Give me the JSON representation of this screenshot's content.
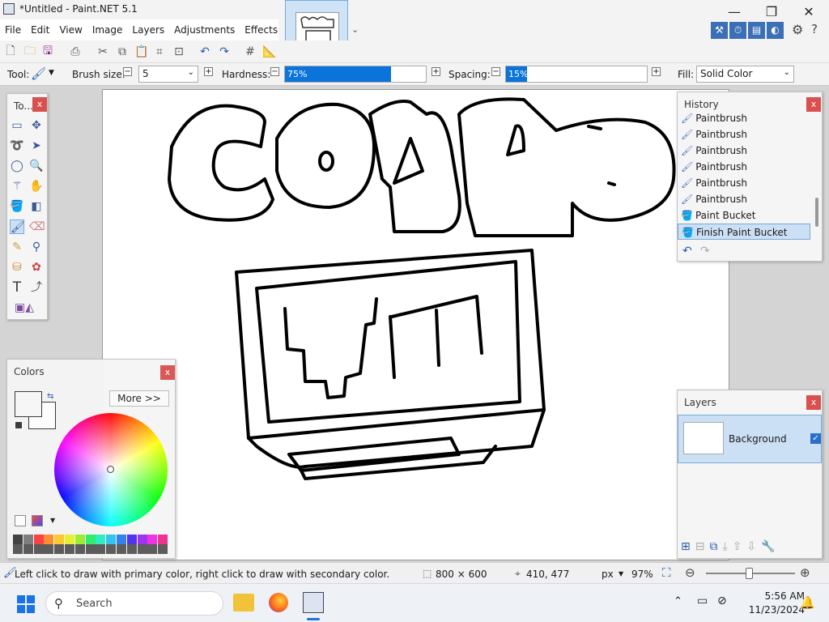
{
  "window": {
    "title": "*Untitled - Paint.NET 5.1",
    "minimize": "—",
    "maximize": "❐",
    "close": "✕"
  },
  "menu": [
    "File",
    "Edit",
    "View",
    "Image",
    "Layers",
    "Adjustments",
    "Effects"
  ],
  "toolbar": {
    "tool_label": "Tool:",
    "brush_size_label": "Brush size:",
    "brush_size_value": "5",
    "hardness_label": "Hardness:",
    "hardness_value": "75%",
    "hardness_fraction": 0.75,
    "spacing_label": "Spacing:",
    "spacing_value": "15%",
    "spacing_fraction": 0.15,
    "fill_label": "Fill:",
    "fill_value": "Solid Color"
  },
  "tools_panel": {
    "title": "To...",
    "close": "x"
  },
  "history_panel": {
    "title": "History",
    "close": "x",
    "items": [
      "Paintbrush",
      "Paintbrush",
      "Paintbrush",
      "Paintbrush",
      "Paintbrush",
      "Paintbrush",
      "Paint Bucket",
      "Finish Paint Bucket"
    ],
    "selected_index": 7
  },
  "colors_panel": {
    "title": "Colors",
    "close": "x",
    "more_button": "More >>",
    "palette": [
      "#3c3c3c",
      "#7a7a7a",
      "#ff3b3b",
      "#ff8a2a",
      "#ffc82a",
      "#eaf02a",
      "#9aee2a",
      "#2aee6a",
      "#2aeebf",
      "#2ac0ee",
      "#2a7aee",
      "#4a2aee",
      "#9a2aee",
      "#ee2ae0",
      "#ee2a8a"
    ]
  },
  "layers_panel": {
    "title": "Layers",
    "close": "x",
    "layer_name": "Background"
  },
  "status": {
    "hint": "Left click to draw with primary color, right click to draw with secondary color.",
    "image_size": "800 × 600",
    "cursor_pos": "410, 477",
    "units": "px",
    "zoom": "97%"
  },
  "taskbar": {
    "search_placeholder": "Search",
    "time": "5:56 AM",
    "date": "11/23/2024"
  },
  "colors": {
    "accent": "#0a74da",
    "close_red": "#d9504f",
    "selection": "#cce0f5"
  }
}
